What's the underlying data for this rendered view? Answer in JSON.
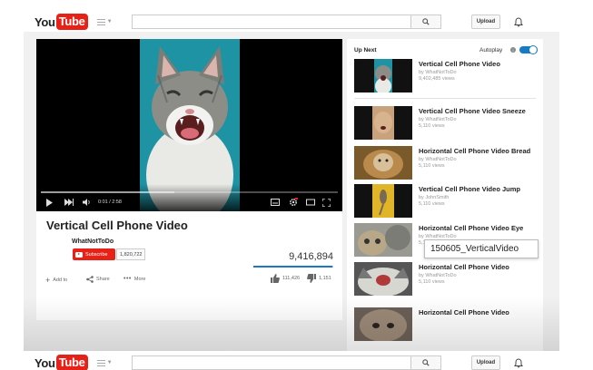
{
  "header": {
    "logo_you": "You",
    "logo_tube": "Tube",
    "upload_label": "Upload"
  },
  "player": {
    "time": "0:01 / 2:58"
  },
  "video": {
    "title": "Vertical Cell Phone Video",
    "channel": "WhatNotToDo",
    "subscribe_label": "Subscribe",
    "subscriber_count": "1,820,722",
    "views": "9,416,894",
    "add_to_label": "Add to",
    "share_label": "Share",
    "more_label": "More",
    "likes": "111,426",
    "dislikes": "1,151"
  },
  "sidebar": {
    "up_next_label": "Up Next",
    "autoplay_label": "Autoplay",
    "autoplay_on": true,
    "items": [
      {
        "title": "Vertical Cell Phone Video",
        "channel": "by WhatNotToDo",
        "views": "9,402,485 views"
      },
      {
        "title": "Vertical Cell Phone Video Sneeze",
        "channel": "by WhatNotToDo",
        "views": "5,110 views"
      },
      {
        "title": "Horizontal Cell Phone Video Bread",
        "channel": "by WhatNotToDo",
        "views": "5,110 views"
      },
      {
        "title": "Vertical Cell Phone Video Jump",
        "channel": "by JohnSmith",
        "views": "5,110 views"
      },
      {
        "title": "Horizontal Cell Phone Video Eye",
        "channel": "by WhatNotToDo",
        "views": "5,110 views"
      },
      {
        "title": "Horizontal Cell Phone Video",
        "channel": "by WhatNotToDo",
        "views": "5,110 views"
      },
      {
        "title": "Horizontal Cell Phone Video",
        "channel": "",
        "views": ""
      }
    ]
  },
  "tooltip": {
    "text": "150605_VerticalVideo"
  },
  "colors": {
    "brand_red": "#e62117",
    "accent_blue": "#167ac6"
  }
}
